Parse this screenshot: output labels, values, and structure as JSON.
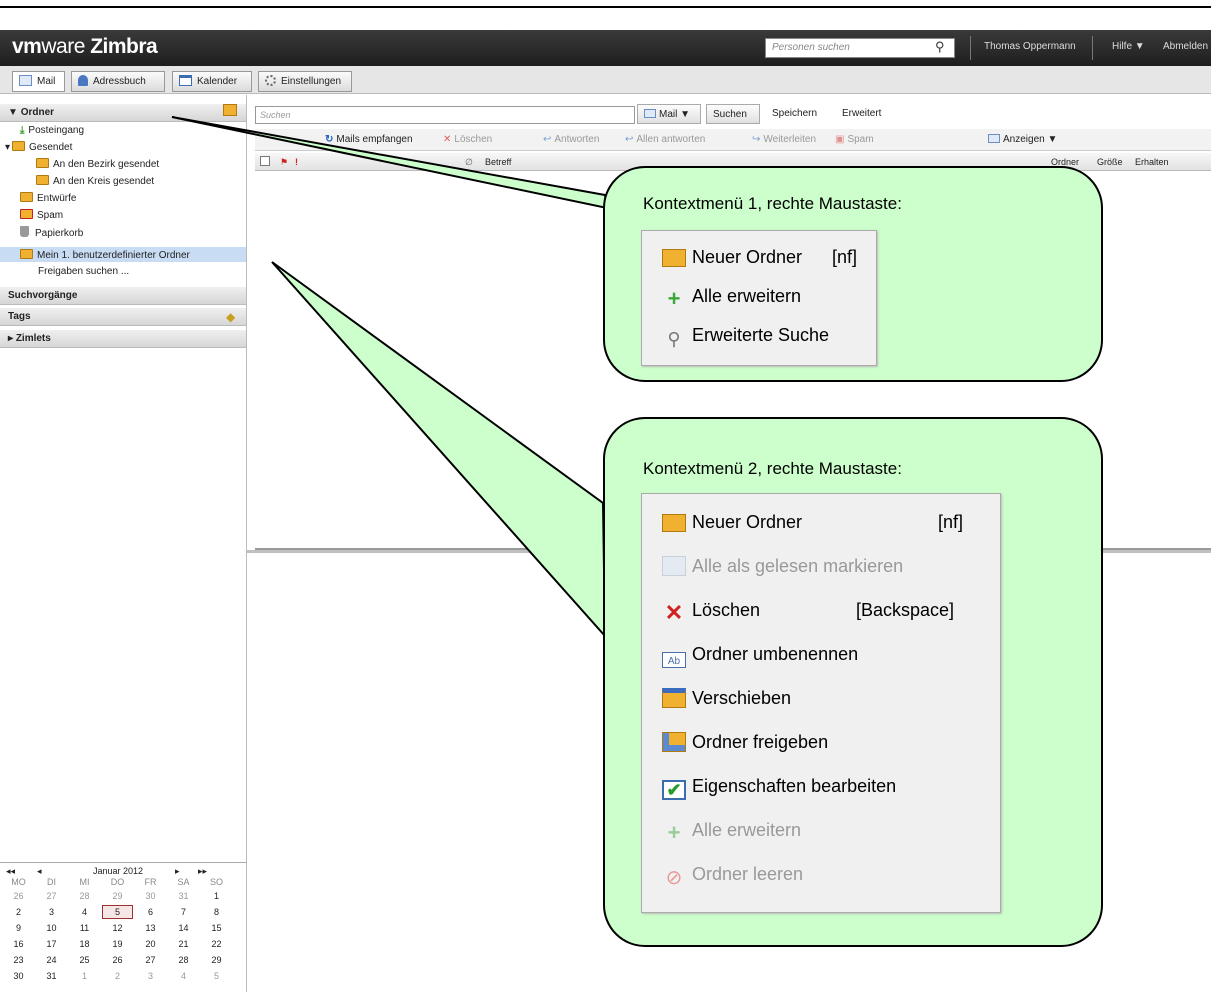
{
  "header": {
    "logo_brand": "vm",
    "logo_ware": "ware",
    "logo_product": " Zimbra",
    "people_search_placeholder": "Personen suchen",
    "user": "Thomas Oppermann",
    "help": "Hilfe ▼",
    "logout": "Abmelden"
  },
  "apptabs": [
    {
      "label": "Mail",
      "icon": "mail-icon"
    },
    {
      "label": "Adressbuch",
      "icon": "addressbook-icon"
    },
    {
      "label": "Kalender",
      "icon": "calendar-icon"
    },
    {
      "label": "Einstellungen",
      "icon": "gear-icon"
    }
  ],
  "sidebar": {
    "folders_header": "Ordner",
    "folders": [
      "Posteingang",
      "Gesendet",
      "An den Bezirk gesendet",
      "An den Kreis gesendet",
      "Entwürfe",
      "Spam",
      "Papierkorb",
      "Mein 1. benutzerdefinierter Ordner",
      "Freigaben suchen ..."
    ],
    "searches_header": "Suchvorgänge",
    "tags_header": "Tags",
    "zimlets_header": "Zimlets"
  },
  "search": {
    "placeholder": "Suchen",
    "type_label": "Mail ▼",
    "search_button": "Suchen",
    "save_button": "Speichern",
    "advanced_button": "Erweitert"
  },
  "toolbar": {
    "receive": "Mails empfangen",
    "delete": "Löschen",
    "reply": "Antworten",
    "reply_all": "Allen antworten",
    "forward": "Weiterleiten",
    "spam": "Spam",
    "view": "Anzeigen ▼"
  },
  "columns": {
    "subject": "Betreff",
    "folder": "Ordner",
    "size": "Größe",
    "received": "Erhalten"
  },
  "calendar": {
    "prev_year": "◂◂",
    "prev_month": "◂",
    "title": "Januar 2012",
    "next_month": "▸",
    "next_year": "▸▸",
    "weekdays": [
      "MO",
      "DI",
      "MI",
      "DO",
      "FR",
      "SA",
      "SO"
    ],
    "weeks": [
      [
        "26",
        "27",
        "28",
        "29",
        "30",
        "31",
        "1"
      ],
      [
        "2",
        "3",
        "4",
        "5",
        "6",
        "7",
        "8"
      ],
      [
        "9",
        "10",
        "11",
        "12",
        "13",
        "14",
        "15"
      ],
      [
        "16",
        "17",
        "18",
        "19",
        "20",
        "21",
        "22"
      ],
      [
        "23",
        "24",
        "25",
        "26",
        "27",
        "28",
        "29"
      ],
      [
        "30",
        "31",
        "1",
        "2",
        "3",
        "4",
        "5"
      ]
    ],
    "today": "5"
  },
  "callout1": {
    "title": "Kontextmenü 1, rechte Maustaste:",
    "items": [
      {
        "label": "Neuer Ordner",
        "shortcut": "[nf]",
        "icon": "new-folder-icon"
      },
      {
        "label": "Alle erweitern",
        "icon": "plus-icon"
      },
      {
        "label": "Erweiterte Suche",
        "icon": "advanced-search-icon"
      }
    ]
  },
  "callout2": {
    "title": "Kontextmenü 2, rechte Maustaste:",
    "items": [
      {
        "label": "Neuer Ordner",
        "shortcut": "[nf]",
        "icon": "new-folder-icon"
      },
      {
        "label": "Alle als gelesen markieren",
        "icon": "mark-read-icon"
      },
      {
        "label": "Löschen",
        "shortcut": "[Backspace]",
        "icon": "delete-icon"
      },
      {
        "label": "Ordner umbenennen",
        "icon": "rename-icon"
      },
      {
        "label": "Verschieben",
        "icon": "move-icon"
      },
      {
        "label": "Ordner freigeben",
        "icon": "share-folder-icon"
      },
      {
        "label": "Eigenschaften bearbeiten",
        "icon": "properties-icon"
      },
      {
        "label": "Alle erweitern",
        "icon": "plus-icon"
      },
      {
        "label": "Ordner leeren",
        "icon": "empty-folder-icon"
      }
    ]
  },
  "colors": {
    "callout_fill": "#ccffcc",
    "header_bg": "#2b2b2b",
    "selection": "#c8dcf4",
    "delete_red": "#d22020"
  }
}
